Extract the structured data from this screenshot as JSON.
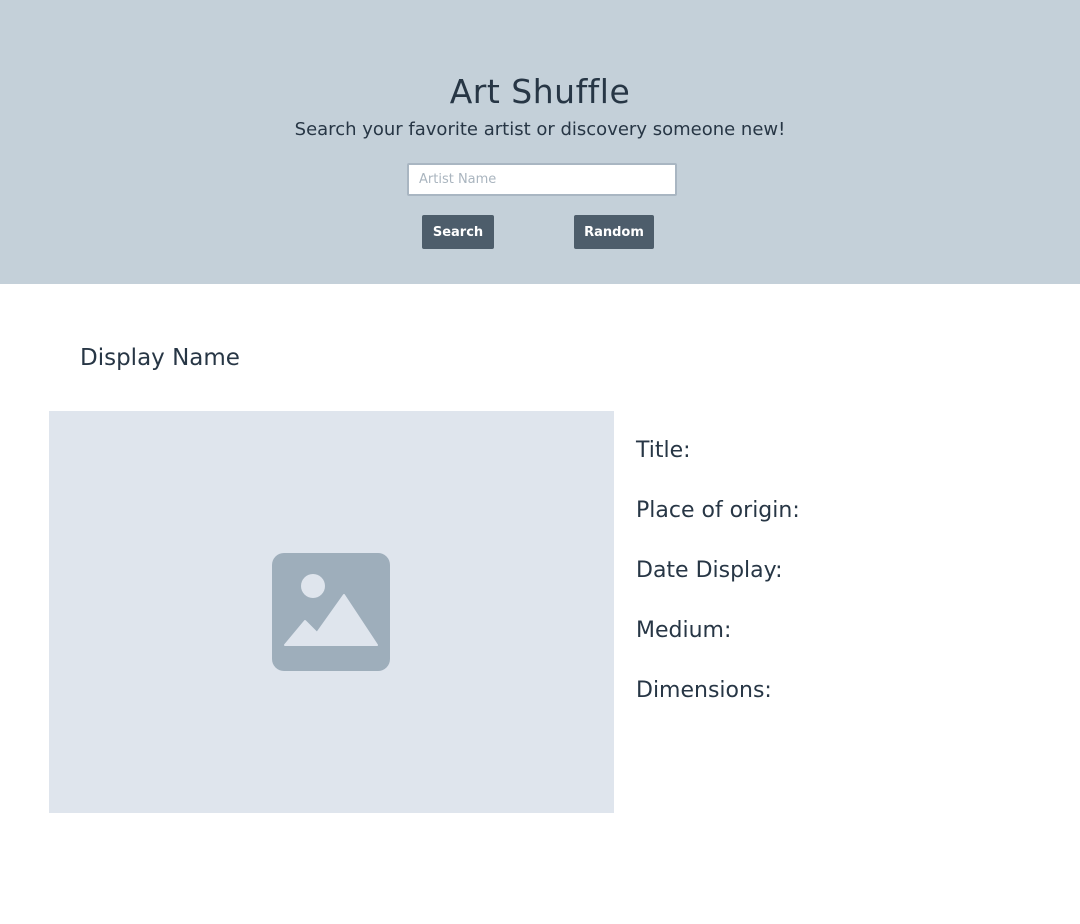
{
  "header": {
    "title": "Art Shuffle",
    "subtitle": "Search your favorite artist or discovery someone new!",
    "search_placeholder": "Artist Name",
    "search_value": "",
    "search_label": "Search",
    "random_label": "Random",
    "background_color": "#c4d0d9",
    "button_color": "#4d5d6b"
  },
  "artwork": {
    "display_name": "Display Name",
    "image_icon": "image-placeholder-icon",
    "fields": {
      "title": "Title:",
      "place_of_origin": "Place of origin:",
      "date_display": "Date Display:",
      "medium": "Medium:",
      "dimensions": "Dimensions:"
    }
  }
}
